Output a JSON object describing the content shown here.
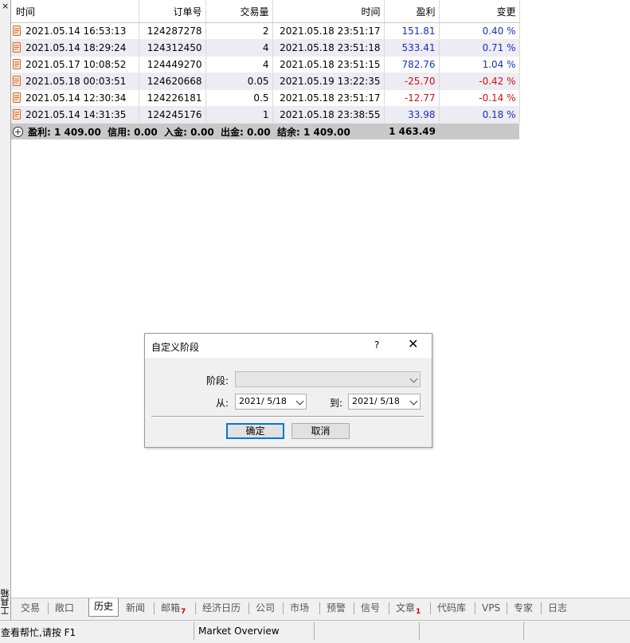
{
  "side_panel": {
    "close_label": "×",
    "title": "工具箱"
  },
  "table": {
    "headers": [
      "时间",
      "订单号",
      "交易量",
      "时间",
      "盈利",
      "变更"
    ],
    "rows": [
      {
        "open_time": "2021.05.14 16:53:13",
        "order": "124287278",
        "volume": "2",
        "close_time": "2021.05.18 23:51:17",
        "profit": "151.81",
        "change": "0.40 %",
        "sign": "pos"
      },
      {
        "open_time": "2021.05.14 18:29:24",
        "order": "124312450",
        "volume": "4",
        "close_time": "2021.05.18 23:51:18",
        "profit": "533.41",
        "change": "0.71 %",
        "sign": "pos"
      },
      {
        "open_time": "2021.05.17 10:08:52",
        "order": "124449270",
        "volume": "4",
        "close_time": "2021.05.18 23:51:15",
        "profit": "782.76",
        "change": "1.04 %",
        "sign": "pos"
      },
      {
        "open_time": "2021.05.18 00:03:51",
        "order": "124620668",
        "volume": "0.05",
        "close_time": "2021.05.19 13:22:35",
        "profit": "-25.70",
        "change": "-0.42 %",
        "sign": "neg"
      },
      {
        "open_time": "2021.05.14 12:30:34",
        "order": "124226181",
        "volume": "0.5",
        "close_time": "2021.05.18 23:51:17",
        "profit": "-12.77",
        "change": "-0.14 %",
        "sign": "neg"
      },
      {
        "open_time": "2021.05.14 14:31:35",
        "order": "124245176",
        "volume": "1",
        "close_time": "2021.05.18 23:38:55",
        "profit": "33.98",
        "change": "0.18 %",
        "sign": "pos"
      }
    ],
    "summary": {
      "text": "盈利: 1 409.00  信用: 0.00  入金: 0.00  出金: 0.00  结余: 1 409.00",
      "total": "1 463.49"
    }
  },
  "dialog": {
    "title": "自定义阶段",
    "help": "?",
    "close": "✕",
    "period_label": "阶段:",
    "period_value": "",
    "from_label": "从:",
    "from_value": "2021/ 5/18",
    "to_label": "到:",
    "to_value": "2021/ 5/18",
    "ok_label": "确定",
    "cancel_label": "取消"
  },
  "tabs": [
    {
      "label": "交易",
      "badge": ""
    },
    {
      "label": "敞口",
      "badge": ""
    },
    {
      "label": "历史",
      "badge": "",
      "active": true
    },
    {
      "label": "新闻",
      "badge": ""
    },
    {
      "label": "邮箱",
      "badge": "7"
    },
    {
      "label": "经济日历",
      "badge": ""
    },
    {
      "label": "公司",
      "badge": ""
    },
    {
      "label": "市场",
      "badge": ""
    },
    {
      "label": "预警",
      "badge": ""
    },
    {
      "label": "信号",
      "badge": ""
    },
    {
      "label": "文章",
      "badge": "1"
    },
    {
      "label": "代码库",
      "badge": ""
    },
    {
      "label": "VPS",
      "badge": ""
    },
    {
      "label": "专家",
      "badge": ""
    },
    {
      "label": "日志",
      "badge": ""
    }
  ],
  "status": {
    "help": "查看帮忙,请按 F1",
    "market": "Market Overview"
  },
  "colors": {
    "positive": "#1a2fc0",
    "negative": "#d01010",
    "summary_bg": "#c8c8c8",
    "accent": "#0078d7"
  }
}
